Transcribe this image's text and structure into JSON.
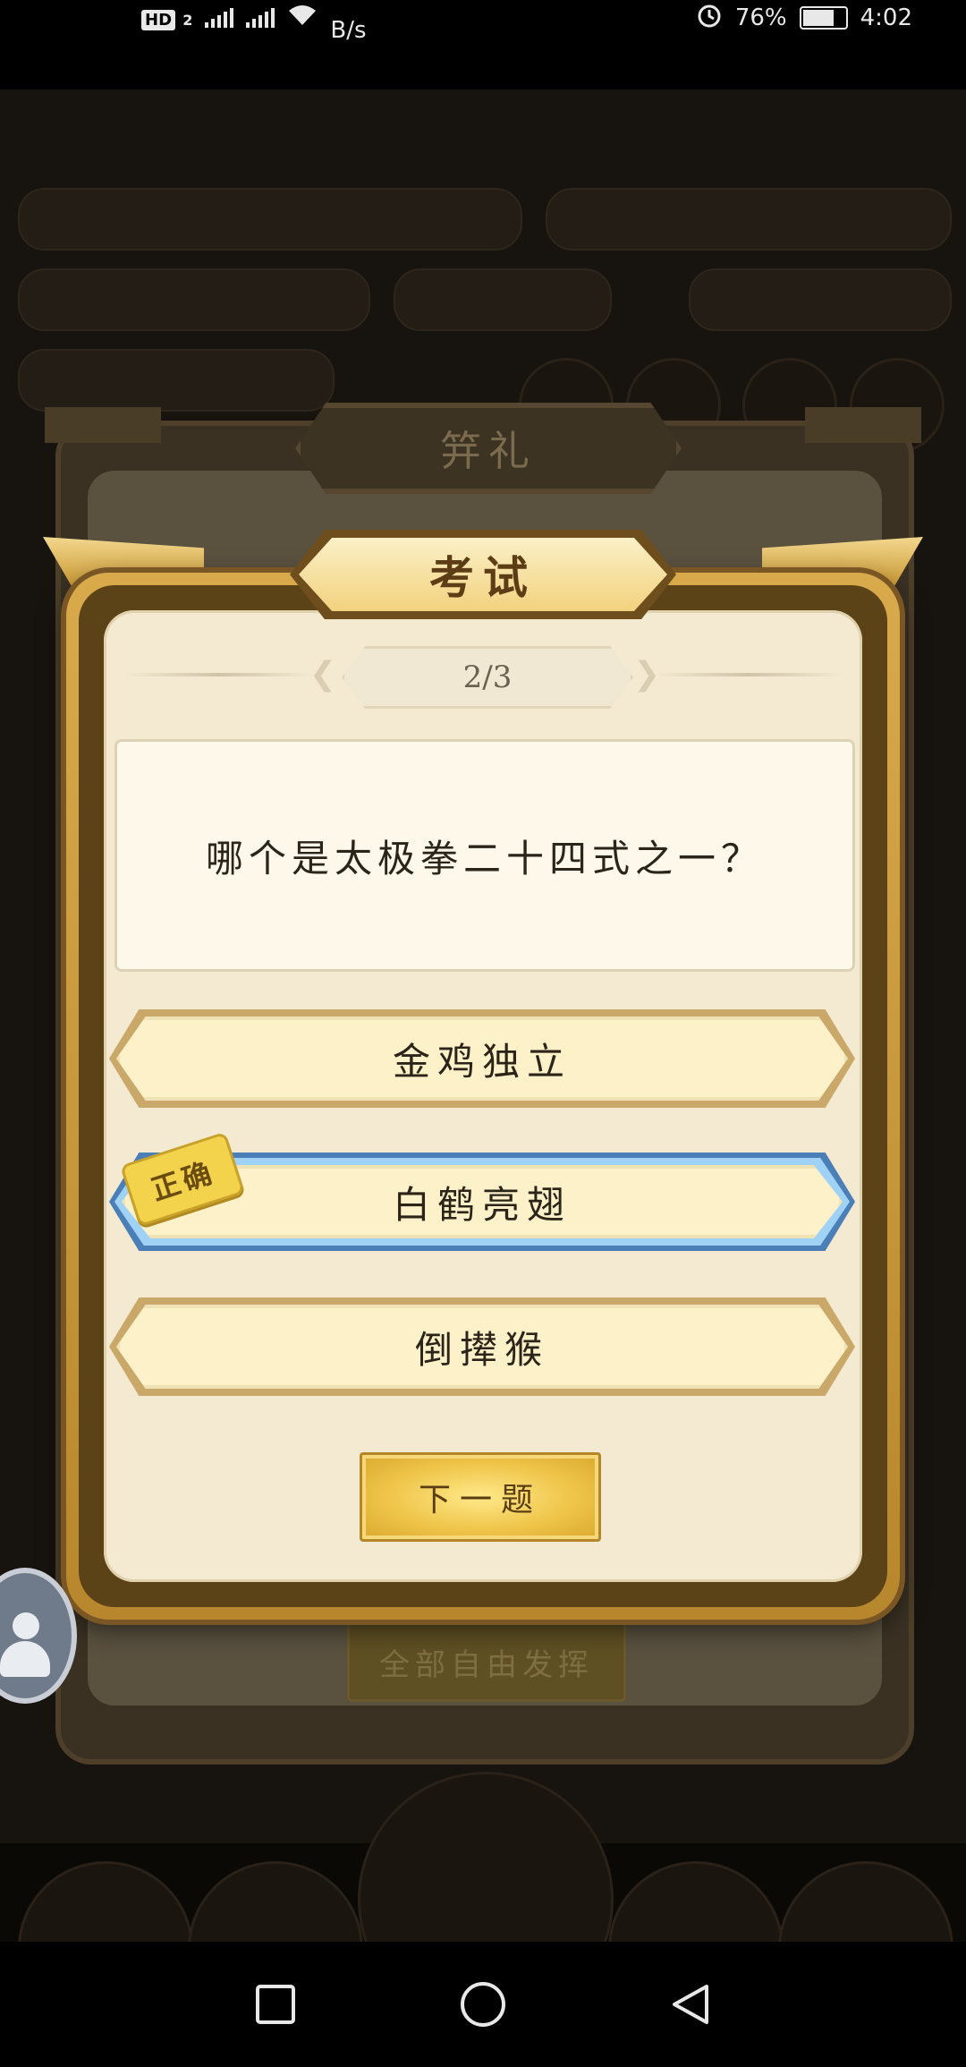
{
  "status_bar": {
    "network_badge": "HD",
    "sim_index": "2",
    "speed": "B/s",
    "battery": "76%",
    "time": "4:02",
    "battery_level": 0.76
  },
  "background": {
    "panel_title": "笄礼",
    "button_label": "全部自由发挥"
  },
  "exam": {
    "title": "考试",
    "progress": "2/3",
    "question": "哪个是太极拳二十四式之一？",
    "options": [
      {
        "label": "金鸡独立",
        "state": "normal"
      },
      {
        "label": "白鹤亮翅",
        "state": "correct"
      },
      {
        "label": "倒撵猴",
        "state": "normal"
      }
    ],
    "correct_tag": "正确",
    "next_button": "下一题"
  },
  "nav": {
    "icons": [
      "recent-apps-icon",
      "home-icon",
      "back-icon"
    ]
  },
  "colors": {
    "correct_border": "#4b7fb7",
    "option_fill": "#fcf1c9",
    "frame_gold": "#d8aa4b",
    "next_button": "#efc54a"
  }
}
